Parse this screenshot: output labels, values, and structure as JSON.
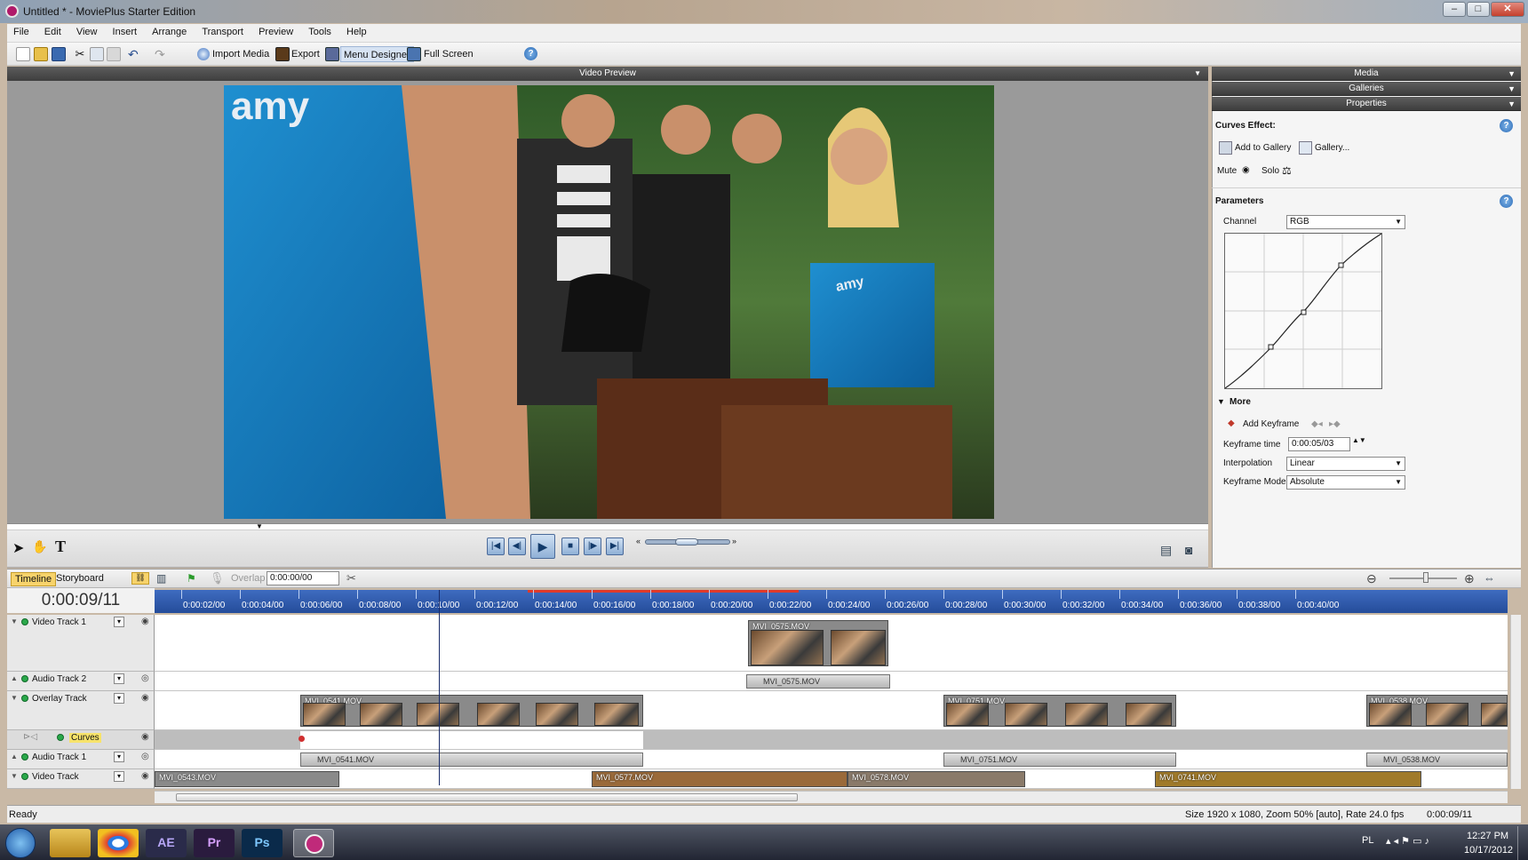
{
  "window": {
    "title": "Untitled * - MoviePlus Starter Edition",
    "minimize": "–",
    "maximize": "□",
    "close": "✕"
  },
  "menu": [
    "File",
    "Edit",
    "View",
    "Insert",
    "Arrange",
    "Transport",
    "Preview",
    "Tools",
    "Help"
  ],
  "toolbar": {
    "import_media": "Import Media",
    "export": "Export",
    "menu_designer": "Menu Designer",
    "full_screen": "Full Screen",
    "help": "?"
  },
  "video_preview": {
    "title": "Video Preview",
    "overlay_text": "amy",
    "shirt_text": "amy"
  },
  "right_panel": {
    "tabs": [
      "Media",
      "Galleries",
      "Properties"
    ],
    "effect_title": "Curves Effect:",
    "add_to_gallery": "Add to Gallery",
    "gallery": "Gallery...",
    "mute": "Mute",
    "solo": "Solo",
    "parameters": "Parameters",
    "channel_label": "Channel",
    "channel_value": "RGB",
    "more": "More",
    "add_keyframe": "Add Keyframe",
    "keyframe_time_label": "Keyframe time",
    "keyframe_time_value": "0:00:05/03",
    "interpolation_label": "Interpolation",
    "interpolation_value": "Linear",
    "keyframe_mode_label": "Keyframe Mode",
    "keyframe_mode_value": "Absolute",
    "help": "?"
  },
  "timeline": {
    "tab_timeline": "Timeline",
    "tab_storyboard": "Storyboard",
    "overlap_label": "Overlap",
    "overlap_value": "0:00:00/00",
    "current_time": "0:00:09/11",
    "ruler": [
      "0:00:02/00",
      "0:00:04/00",
      "0:00:06/00",
      "0:00:08/00",
      "0:00:10/00",
      "0:00:12/00",
      "0:00:14/00",
      "0:00:16/00",
      "0:00:18/00",
      "0:00:20/00",
      "0:00:22/00",
      "0:00:24/00",
      "0:00:26/00",
      "0:00:28/00",
      "0:00:30/00",
      "0:00:32/00",
      "0:00:34/00",
      "0:00:36/00",
      "0:00:38/00",
      "0:00:40/00"
    ],
    "tracks": {
      "video1": "Video Track 1",
      "audio2": "Audio Track 2",
      "overlay": "Overlay Track",
      "curves": "Curves",
      "audio1": "Audio Track 1",
      "video": "Video Track"
    },
    "clips": {
      "v1": "MVI_0575.MOV",
      "a2": "MVI_0575.MOV",
      "ov1": "MVI_0541.MOV",
      "ov2": "MVI_0751.MOV",
      "ov3": "MVI_0538.MOV",
      "a1a": "MVI_0541.MOV",
      "a1b": "MVI_0751.MOV",
      "a1c": "MVI_0538.MOV",
      "vt1": "MVI_0543.MOV",
      "vt2": "MVI_0577.MOV",
      "vt3": "MVI_0578.MOV",
      "vt4": "MVI_0741.MOV"
    }
  },
  "status": {
    "ready": "Ready",
    "info": "Size 1920 x 1080, Zoom 50% [auto], Rate 24.0 fps",
    "time": "0:00:09/11"
  },
  "taskbar": {
    "apps": [
      "AE",
      "Pr",
      "Ps"
    ],
    "lang": "PL",
    "clock_time": "12:27 PM",
    "clock_date": "10/17/2012"
  }
}
